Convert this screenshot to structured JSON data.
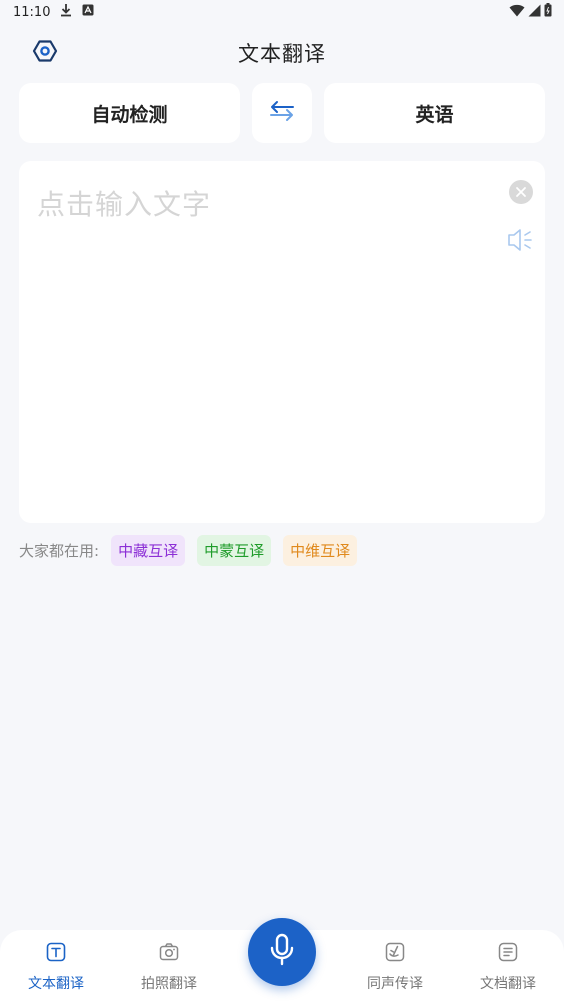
{
  "status_bar": {
    "time": "11:10"
  },
  "header": {
    "title": "文本翻译"
  },
  "languages": {
    "source": "自动检测",
    "target": "英语"
  },
  "input": {
    "placeholder": "点击输入文字",
    "value": ""
  },
  "popular": {
    "label": "大家都在用:",
    "chips": [
      {
        "label": "中藏互译",
        "color": "#8c2fd6",
        "bg": "#f0e4fb"
      },
      {
        "label": "中蒙互译",
        "color": "#1f9c2a",
        "bg": "#e2f5e3"
      },
      {
        "label": "中维互译",
        "color": "#e0891c",
        "bg": "#fcf0e0"
      }
    ]
  },
  "bottom_nav": {
    "items": [
      {
        "label": "文本翻译",
        "icon": "text-t-icon",
        "active": true
      },
      {
        "label": "拍照翻译",
        "icon": "camera-icon",
        "active": false
      },
      {
        "label": "同声传译",
        "icon": "simultaneous-icon",
        "active": false
      },
      {
        "label": "文档翻译",
        "icon": "document-icon",
        "active": false
      }
    ],
    "mic_icon": "microphone-icon"
  },
  "colors": {
    "accent": "#1c62c7",
    "background": "#f6f7fa"
  }
}
